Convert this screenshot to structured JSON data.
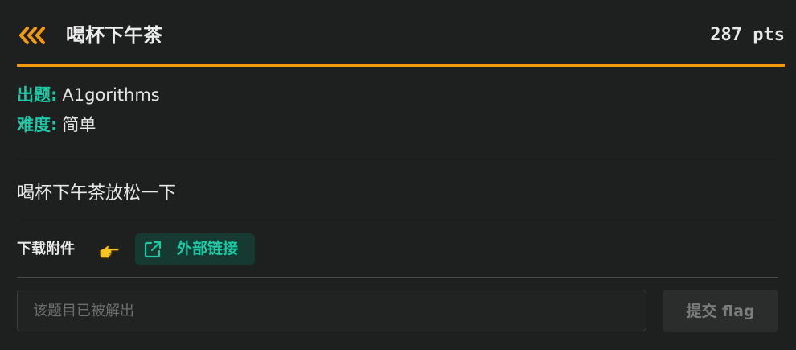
{
  "challenge": {
    "title": "喝杯下午茶",
    "points": "287 pts",
    "author_label": "出题:",
    "author_value": "A1gorithms",
    "difficulty_label": "难度:",
    "difficulty_value": "简单",
    "description": "喝杯下午茶放松一下"
  },
  "attachments": {
    "label": "下载附件",
    "pointer_icon": "hand-pointing-right-icon",
    "external_link_label": "外部链接",
    "external_link_icon": "external-link-icon"
  },
  "flag_form": {
    "placeholder": "该题目已被解出",
    "value": "",
    "submit_label": "提交 flag",
    "submit_disabled": true
  },
  "header": {
    "back_icon": "triple-chevron-left-icon"
  },
  "colors": {
    "accent_orange": "#f29a0b",
    "accent_teal": "#1ec8a5",
    "background": "#1e1f1f"
  }
}
